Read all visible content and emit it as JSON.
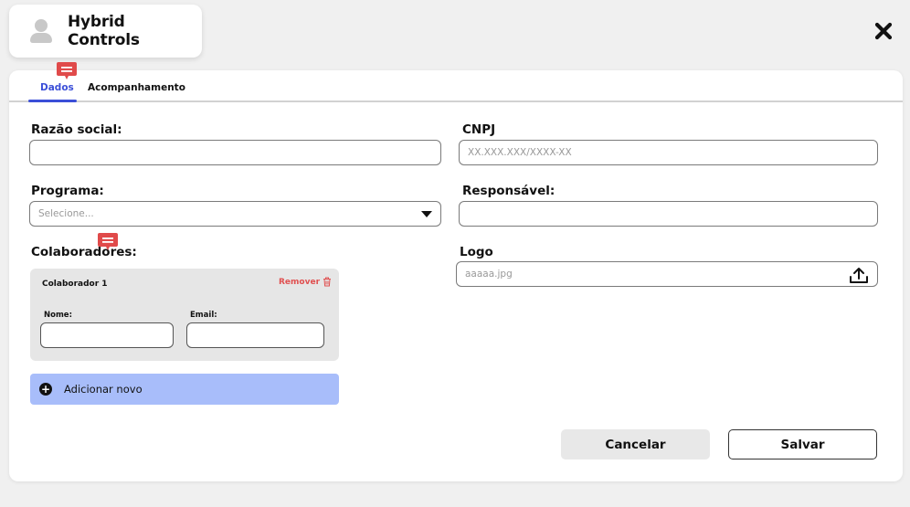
{
  "header": {
    "app_title": "Hybrid Controls",
    "avatar_icon": "user-avatar-icon"
  },
  "close_icon": "close-icon",
  "tabs": [
    {
      "label": "Dados",
      "active": true
    },
    {
      "label": "Acompanhamento",
      "active": false
    }
  ],
  "form": {
    "razao_social": {
      "label": "Razão social:",
      "value": "",
      "placeholder": ""
    },
    "cnpj": {
      "label": "CNPJ",
      "value": "",
      "placeholder": "XX.XXX.XXX/XXXX-XX"
    },
    "programa": {
      "label": "Programa:",
      "selected": "Selecione..."
    },
    "responsavel": {
      "label": "Responsável:",
      "value": ""
    },
    "logo": {
      "label": "Logo",
      "value": "aaaaa.jpg"
    },
    "colaboradores": {
      "label": "Colaboradores:",
      "items": [
        {
          "title": "Colaborador 1",
          "remove_label": "Remover",
          "nome_label": "Nome:",
          "email_label": "Email:",
          "nome_value": "",
          "email_value": ""
        }
      ],
      "add_label": "Adicionar novo"
    }
  },
  "actions": {
    "cancel_label": "Cancelar",
    "save_label": "Salvar"
  },
  "colors": {
    "accent": "#3b4fd8",
    "add_button": "#a8bdfa",
    "remove": "#e05050",
    "comment": "#e04a4a"
  }
}
